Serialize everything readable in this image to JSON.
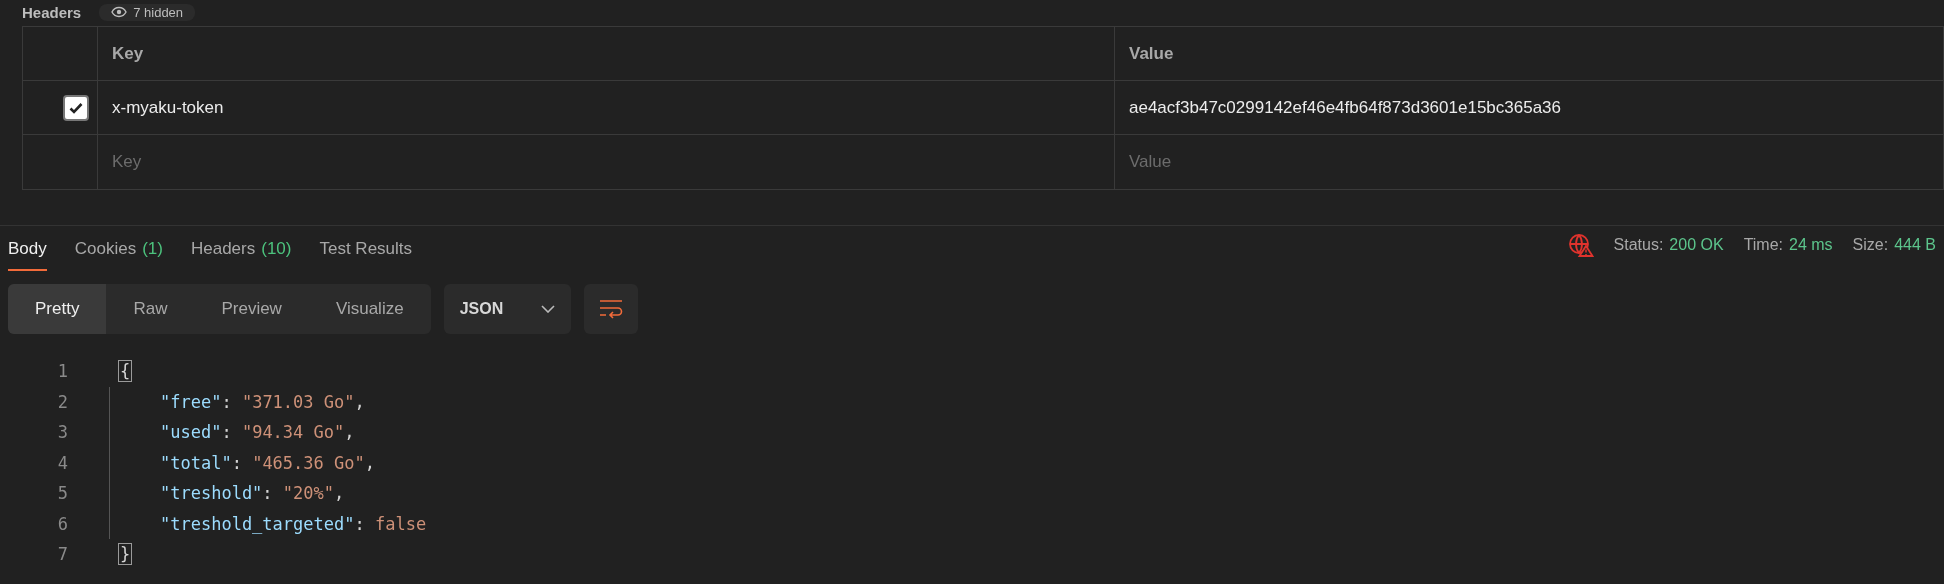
{
  "section": {
    "title": "Headers",
    "hidden_badge": "7 hidden"
  },
  "headers_table": {
    "columns": [
      "Key",
      "Value"
    ],
    "rows": [
      {
        "checked": true,
        "key": "x-myaku-token",
        "value": "ae4acf3b47c0299142ef46e4fb64f873d3601e15bc365a36"
      }
    ],
    "new_row": {
      "key_placeholder": "Key",
      "value_placeholder": "Value"
    }
  },
  "response_tabs": [
    {
      "label": "Body",
      "selected": true
    },
    {
      "label": "Cookies",
      "count": "(1)",
      "selected": false
    },
    {
      "label": "Headers",
      "count": "(10)",
      "selected": false
    },
    {
      "label": "Test Results",
      "selected": false
    }
  ],
  "status_bar": [
    {
      "label": "Status:",
      "value": "200 OK"
    },
    {
      "label": "Time:",
      "value": "24 ms"
    },
    {
      "label": "Size:",
      "value": "444 B"
    }
  ],
  "view_modes": [
    {
      "label": "Pretty",
      "selected": true
    },
    {
      "label": "Raw",
      "selected": false
    },
    {
      "label": "Preview",
      "selected": false
    },
    {
      "label": "Visualize",
      "selected": false
    }
  ],
  "format": "JSON",
  "code_lines": [
    {
      "number": "1",
      "tokens": [
        {
          "kind": "brace",
          "text": "{"
        }
      ]
    },
    {
      "number": "2",
      "tokens": [
        {
          "kind": "key",
          "text": "\"free\""
        },
        {
          "kind": "punct",
          "text": ": "
        },
        {
          "kind": "string",
          "text": "\"371.03 Go\""
        },
        {
          "kind": "punct",
          "text": ","
        }
      ]
    },
    {
      "number": "3",
      "tokens": [
        {
          "kind": "key",
          "text": "\"used\""
        },
        {
          "kind": "punct",
          "text": ": "
        },
        {
          "kind": "string",
          "text": "\"94.34 Go\""
        },
        {
          "kind": "punct",
          "text": ","
        }
      ]
    },
    {
      "number": "4",
      "tokens": [
        {
          "kind": "key",
          "text": "\"total\""
        },
        {
          "kind": "punct",
          "text": ": "
        },
        {
          "kind": "string",
          "text": "\"465.36 Go\""
        },
        {
          "kind": "punct",
          "text": ","
        }
      ]
    },
    {
      "number": "5",
      "tokens": [
        {
          "kind": "key",
          "text": "\"treshold\""
        },
        {
          "kind": "punct",
          "text": ": "
        },
        {
          "kind": "string",
          "text": "\"20%\""
        },
        {
          "kind": "punct",
          "text": ","
        }
      ]
    },
    {
      "number": "6",
      "tokens": [
        {
          "kind": "key",
          "text": "\"treshold_targeted\""
        },
        {
          "kind": "punct",
          "text": ": "
        },
        {
          "kind": "literal",
          "text": "false"
        }
      ]
    },
    {
      "number": "7",
      "tokens": [
        {
          "kind": "brace",
          "text": "}"
        }
      ]
    }
  ]
}
